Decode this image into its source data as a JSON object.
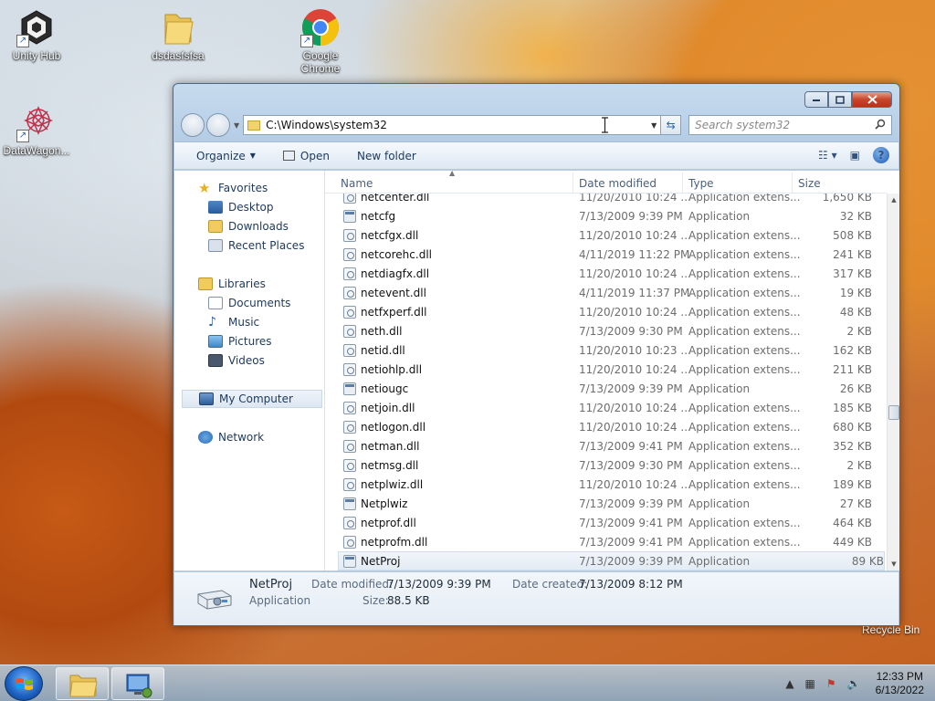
{
  "desktop": {
    "icons": [
      {
        "label": "Unity Hub",
        "icon": "unity-icon"
      },
      {
        "label": "dsdasfsfsa",
        "icon": "folder-icon"
      },
      {
        "label": "Google Chrome",
        "icon": "chrome-icon"
      },
      {
        "label": "DataWagon...",
        "icon": "datawagon-icon"
      }
    ],
    "recycle_bin_label": "Recycle Bin"
  },
  "explorer": {
    "address": "C:\\Windows\\system32",
    "search_placeholder": "Search system32",
    "commands": {
      "organize": "Organize",
      "open": "Open",
      "new_folder": "New folder"
    },
    "nav": {
      "favorites": "Favorites",
      "desktop": "Desktop",
      "downloads": "Downloads",
      "recent_places": "Recent Places",
      "libraries": "Libraries",
      "documents": "Documents",
      "music": "Music",
      "pictures": "Pictures",
      "videos": "Videos",
      "my_computer": "My Computer",
      "network": "Network"
    },
    "columns": {
      "name": "Name",
      "date": "Date modified",
      "type": "Type",
      "size": "Size"
    },
    "files": [
      {
        "name": "netcenter.dll",
        "date": "11/20/2010 10:24 ...",
        "type": "Application extens...",
        "size": "1,650 KB",
        "icon": "dll-icon"
      },
      {
        "name": "netcfg",
        "date": "7/13/2009 9:39 PM",
        "type": "Application",
        "size": "32 KB",
        "icon": "app-icon"
      },
      {
        "name": "netcfgx.dll",
        "date": "11/20/2010 10:24 ...",
        "type": "Application extens...",
        "size": "508 KB",
        "icon": "dll-icon"
      },
      {
        "name": "netcorehc.dll",
        "date": "4/11/2019 11:22 PM",
        "type": "Application extens...",
        "size": "241 KB",
        "icon": "dll-icon"
      },
      {
        "name": "netdiagfx.dll",
        "date": "11/20/2010 10:24 ...",
        "type": "Application extens...",
        "size": "317 KB",
        "icon": "dll-icon"
      },
      {
        "name": "netevent.dll",
        "date": "4/11/2019 11:37 PM",
        "type": "Application extens...",
        "size": "19 KB",
        "icon": "dll-icon"
      },
      {
        "name": "netfxperf.dll",
        "date": "11/20/2010 10:24 ...",
        "type": "Application extens...",
        "size": "48 KB",
        "icon": "dll-icon"
      },
      {
        "name": "neth.dll",
        "date": "7/13/2009 9:30 PM",
        "type": "Application extens...",
        "size": "2 KB",
        "icon": "dll-icon"
      },
      {
        "name": "netid.dll",
        "date": "11/20/2010 10:23 ...",
        "type": "Application extens...",
        "size": "162 KB",
        "icon": "dll-icon"
      },
      {
        "name": "netiohlp.dll",
        "date": "11/20/2010 10:24 ...",
        "type": "Application extens...",
        "size": "211 KB",
        "icon": "dll-icon"
      },
      {
        "name": "netiougc",
        "date": "7/13/2009 9:39 PM",
        "type": "Application",
        "size": "26 KB",
        "icon": "app-icon"
      },
      {
        "name": "netjoin.dll",
        "date": "11/20/2010 10:24 ...",
        "type": "Application extens...",
        "size": "185 KB",
        "icon": "dll-icon"
      },
      {
        "name": "netlogon.dll",
        "date": "11/20/2010 10:24 ...",
        "type": "Application extens...",
        "size": "680 KB",
        "icon": "dll-icon"
      },
      {
        "name": "netman.dll",
        "date": "7/13/2009 9:41 PM",
        "type": "Application extens...",
        "size": "352 KB",
        "icon": "dll-icon"
      },
      {
        "name": "netmsg.dll",
        "date": "7/13/2009 9:30 PM",
        "type": "Application extens...",
        "size": "2 KB",
        "icon": "dll-icon"
      },
      {
        "name": "netplwiz.dll",
        "date": "11/20/2010 10:24 ...",
        "type": "Application extens...",
        "size": "189 KB",
        "icon": "dll-icon"
      },
      {
        "name": "Netplwiz",
        "date": "7/13/2009 9:39 PM",
        "type": "Application",
        "size": "27 KB",
        "icon": "users-icon"
      },
      {
        "name": "netprof.dll",
        "date": "7/13/2009 9:41 PM",
        "type": "Application extens...",
        "size": "464 KB",
        "icon": "dll-icon"
      },
      {
        "name": "netprofm.dll",
        "date": "7/13/2009 9:41 PM",
        "type": "Application extens...",
        "size": "449 KB",
        "icon": "dll-icon"
      },
      {
        "name": "NetProj",
        "date": "7/13/2009 9:39 PM",
        "type": "Application",
        "size": "89 KB",
        "icon": "projector-icon",
        "selected": true
      }
    ],
    "details": {
      "name": "NetProj",
      "type": "Application",
      "date_modified_label": "Date modified:",
      "date_modified": "7/13/2009 9:39 PM",
      "size_label": "Size:",
      "size": "88.5 KB",
      "date_created_label": "Date created:",
      "date_created": "7/13/2009 8:12 PM"
    }
  },
  "taskbar": {
    "time": "12:33 PM",
    "date": "6/13/2022"
  }
}
